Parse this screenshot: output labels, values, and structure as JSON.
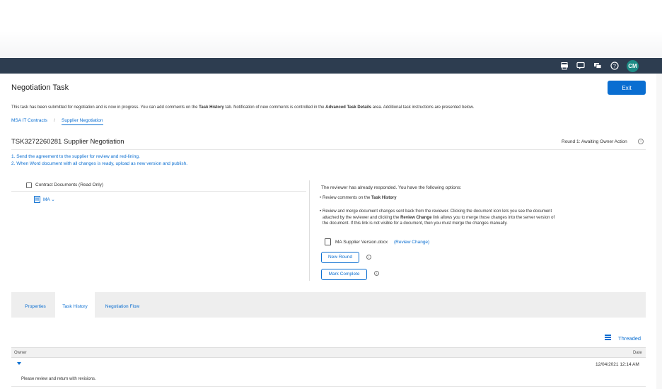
{
  "header": {
    "icons": [
      "print-icon",
      "feedback-icon",
      "chat-icon",
      "help-icon"
    ],
    "avatar_initials": "CM",
    "avatar_color": "#1d8b85",
    "bar_color": "#2d3d50"
  },
  "page": {
    "title": "Negotiation Task",
    "exit_label": "Exit",
    "info_parts": [
      "This task has been submitted for negotiation and is now in progress.  You can add comments on the ",
      "Task History",
      " tab.  Notification of new comments is controlled in the ",
      "Advanced Task Details",
      " area.  Additional task instructions are presented below."
    ],
    "breadcrumb": [
      "MSA IT Contracts",
      "/",
      "Supplier Negotiation"
    ]
  },
  "task": {
    "title": "TSK3272260281 Supplier Negotiation",
    "status": "Round 1: Awaiting Owner Action",
    "steps": [
      "1. Send the agreement to the supplier for review and red-lining.",
      "2. When Word document with all changes is ready, upload as new version and publish."
    ]
  },
  "documents": {
    "folder_label": "Contract Documents (Read Only)",
    "item_label": "MA"
  },
  "reviewer": {
    "intro": "The reviewer has already responded. You have the following options:",
    "bullet1_prefix": "Review comments on the ",
    "bullet1_bold": "Task History",
    "bullet2_line1": "Review and merge document changes sent back from the reviewer. Clicking the document icon lets you see the document",
    "bullet2_line2_pre": "attached by the reviewer and clicking the ",
    "bullet2_line2_bold": "Review Change",
    "bullet2_line2_post": " link allows you to merge those changes into the server version of",
    "bullet2_line3": "the document. If this link is not visible for a document, then you must merge the changes manually.",
    "file_name": "MA Supplier Version.docx",
    "review_change_link": "(Review Change)",
    "new_round_label": "New Round",
    "mark_complete_label": "Mark Complete",
    "info_glyph": "i"
  },
  "tabs": [
    "Properties",
    "Task History",
    "Negotiation Flow"
  ],
  "history": {
    "view_label": "Threaded",
    "columns": [
      "Owner",
      "Date"
    ],
    "rows": [
      {
        "date": "12/04/2021 12:14 AM",
        "message": "Please review and return with revisions."
      }
    ]
  }
}
